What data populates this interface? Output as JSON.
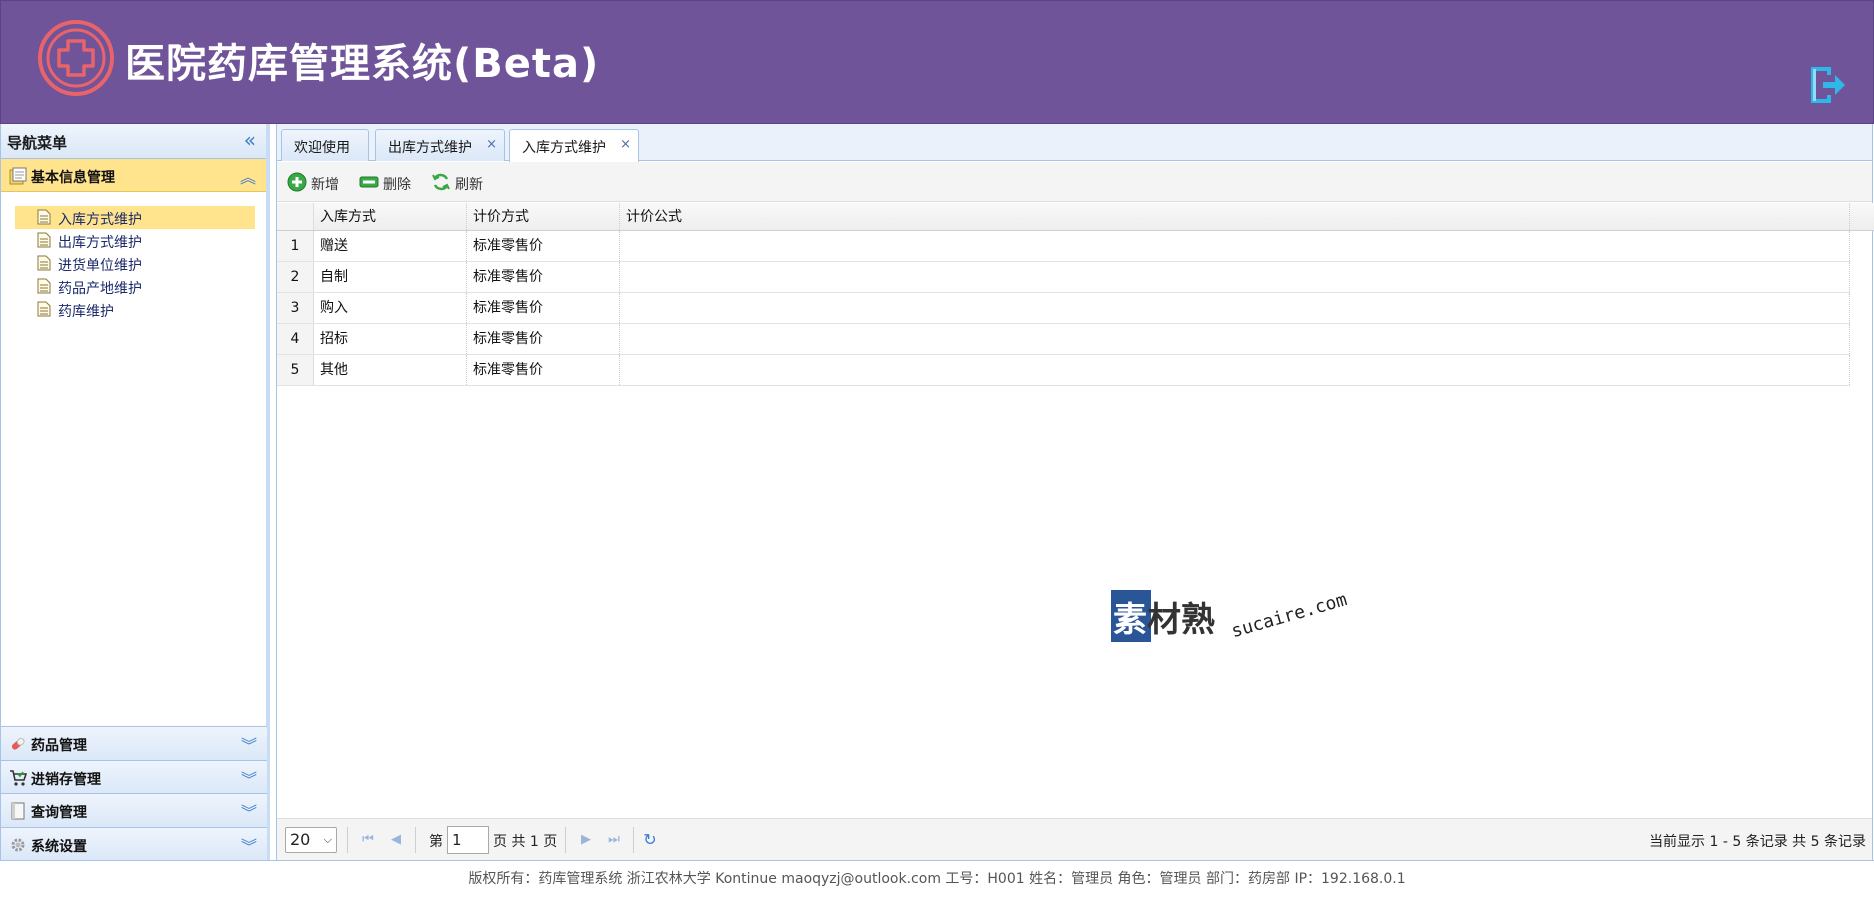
{
  "app": {
    "title": "医院药库管理系统(Beta)"
  },
  "sidebar": {
    "title": "导航菜单",
    "active_section": "基本信息管理",
    "items": [
      {
        "label": "入库方式维护",
        "selected": true
      },
      {
        "label": "出库方式维护",
        "selected": false
      },
      {
        "label": "进货单位维护",
        "selected": false
      },
      {
        "label": "药品产地维护",
        "selected": false
      },
      {
        "label": "药库维护",
        "selected": false
      }
    ],
    "sections": [
      "药品管理",
      "进销存管理",
      "查询管理",
      "系统设置"
    ]
  },
  "tabs": [
    {
      "label": "欢迎使用",
      "closable": false
    },
    {
      "label": "出库方式维护",
      "closable": true
    },
    {
      "label": "入库方式维护",
      "closable": true,
      "active": true
    }
  ],
  "tab_close_glyph": "×",
  "toolbar": {
    "add_label": "新增",
    "delete_label": "删除",
    "refresh_label": "刷新"
  },
  "grid": {
    "columns": [
      "入库方式",
      "计价方式",
      "计价公式"
    ],
    "rows": [
      {
        "num": "1",
        "method": "赠送",
        "pricing": "标准零售价",
        "formula": ""
      },
      {
        "num": "2",
        "method": "自制",
        "pricing": "标准零售价",
        "formula": ""
      },
      {
        "num": "3",
        "method": "购入",
        "pricing": "标准零售价",
        "formula": ""
      },
      {
        "num": "4",
        "method": "招标",
        "pricing": "标准零售价",
        "formula": ""
      },
      {
        "num": "5",
        "method": "其他",
        "pricing": "标准零售价",
        "formula": ""
      }
    ]
  },
  "watermark": {
    "brand": "素材熟",
    "brand_first": "素",
    "brand_rest": "材熟",
    "domain": "sucaire.com"
  },
  "pager": {
    "page_size": "20",
    "page_prefix": "第",
    "current_page": "1",
    "page_suffix": "页 共 1 页",
    "info": "当前显示 1 - 5 条记录 共 5 条记录"
  },
  "footer": {
    "text": "版权所有：药库管理系统 浙江农林大学 Kontinue maoqyzj@outlook.com 工号：H001 姓名：管理员 角色：管理员 部门：药房部 IP：192.168.0.1"
  },
  "colors": {
    "header_bg": "#6f5499",
    "accent": "#3b7cc9",
    "selected": "#ffe48d",
    "logo": "#e8646a"
  }
}
